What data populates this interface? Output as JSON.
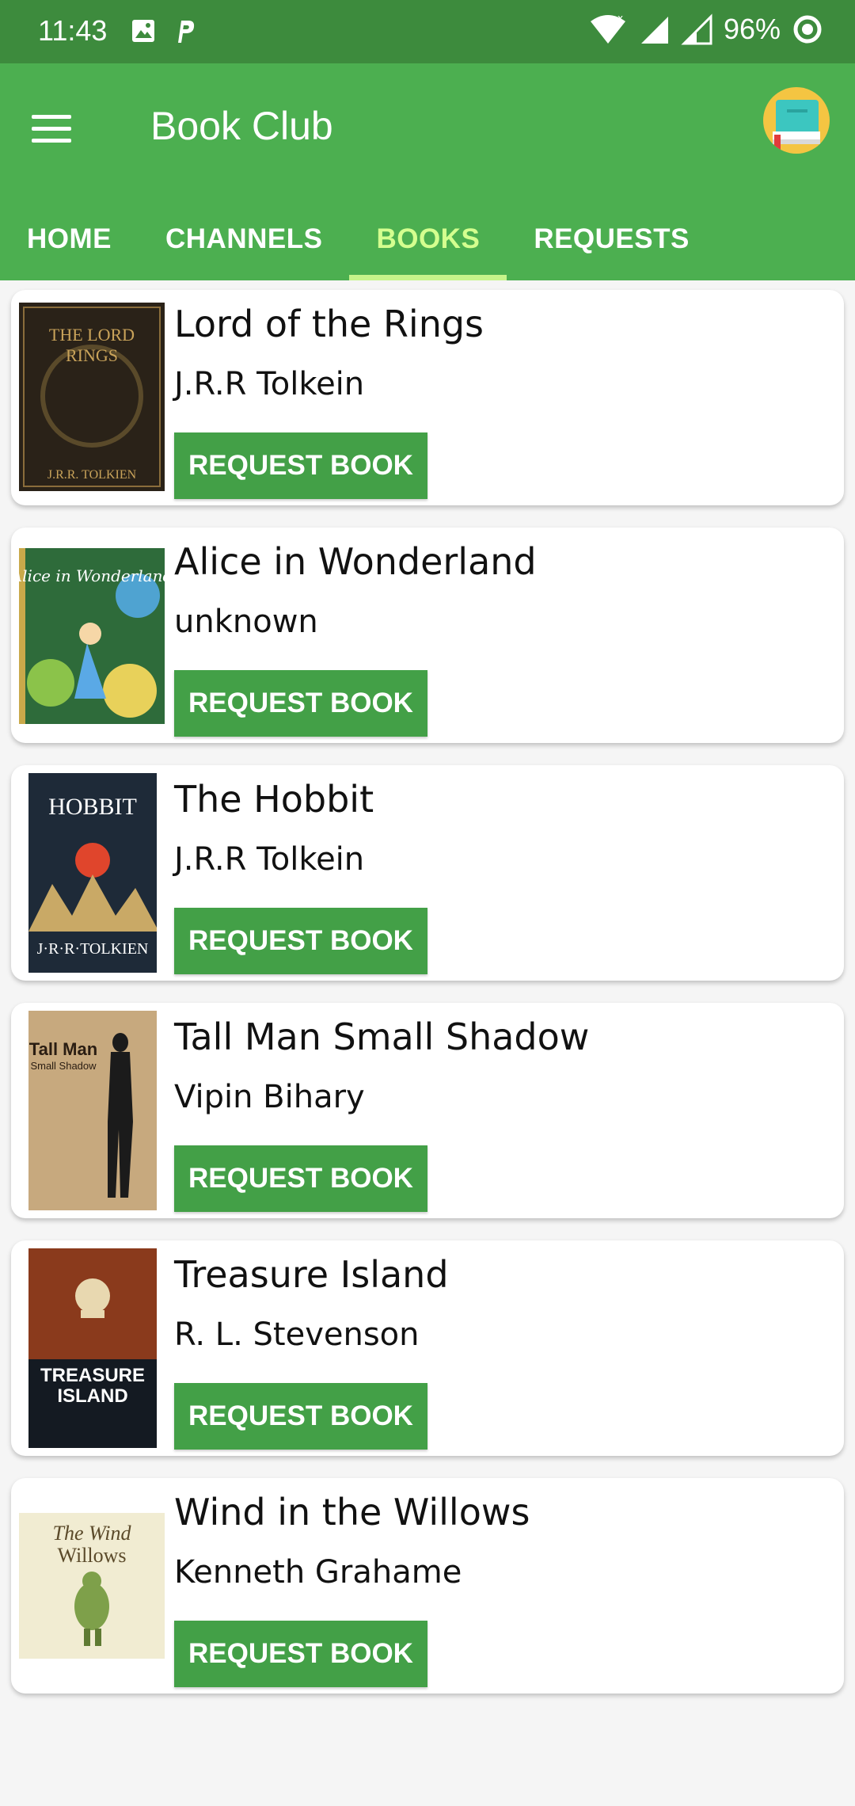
{
  "status": {
    "time": "11:43",
    "battery": "96%"
  },
  "app": {
    "title": "Book Club"
  },
  "tabs": [
    {
      "label": "HOME"
    },
    {
      "label": "CHANNELS"
    },
    {
      "label": "BOOKS"
    },
    {
      "label": "REQUESTS"
    }
  ],
  "active_tab": "BOOKS",
  "books": [
    {
      "title": "Lord of the Rings",
      "author": "J.R.R Tolkein",
      "button": "REQUEST BOOK"
    },
    {
      "title": "Alice in Wonderland",
      "author": "unknown",
      "button": "REQUEST BOOK"
    },
    {
      "title": "The Hobbit",
      "author": "J.R.R Tolkein",
      "button": "REQUEST BOOK"
    },
    {
      "title": "Tall Man Small Shadow",
      "author": "Vipin Bihary",
      "button": "REQUEST BOOK"
    },
    {
      "title": "Treasure Island",
      "author": "R. L. Stevenson",
      "button": "REQUEST BOOK"
    },
    {
      "title": "Wind in the Willows",
      "author": "Kenneth Grahame",
      "button": "REQUEST BOOK"
    }
  ],
  "colors": {
    "primary": "#4caf50",
    "status_bar": "#3d8b3d",
    "accent_tab": "#d4ff8f",
    "button": "#43a047"
  }
}
